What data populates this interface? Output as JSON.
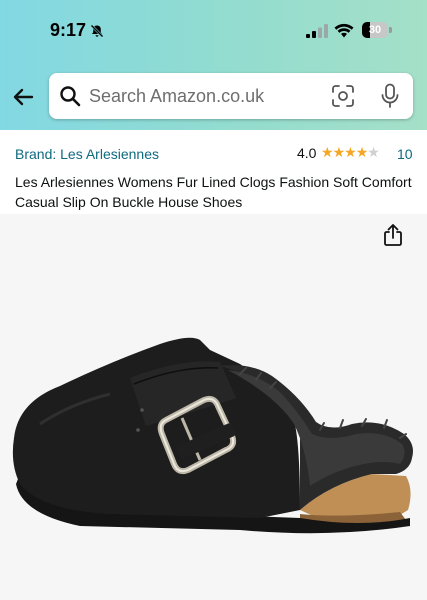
{
  "status_bar": {
    "time": "9:17",
    "battery_level": "30",
    "battery_fraction": 0.3
  },
  "header": {
    "back_icon": "arrow-left-icon",
    "search_placeholder": "Search Amazon.co.uk",
    "camera_icon": "camera-scan-icon",
    "mic_icon": "microphone-icon",
    "gradient_colors": [
      "#82d8e3",
      "#a5e0c8"
    ]
  },
  "product": {
    "brand": "Brand: Les Arlesiennes",
    "rating": "4.0",
    "rating_value": 4.0,
    "rating_max": 5,
    "review_count": "10",
    "title": "Les Arlesiennes Womens Fur Lined Clogs Fashion Soft Comfort Casual Slip On Buckle House Shoes",
    "link_color": "#0f6a7e",
    "star_color": "#f5a623"
  },
  "gallery": {
    "share_icon": "share-icon",
    "image_subject": "black suede fur-lined clog with silver buckle and cork sole"
  }
}
